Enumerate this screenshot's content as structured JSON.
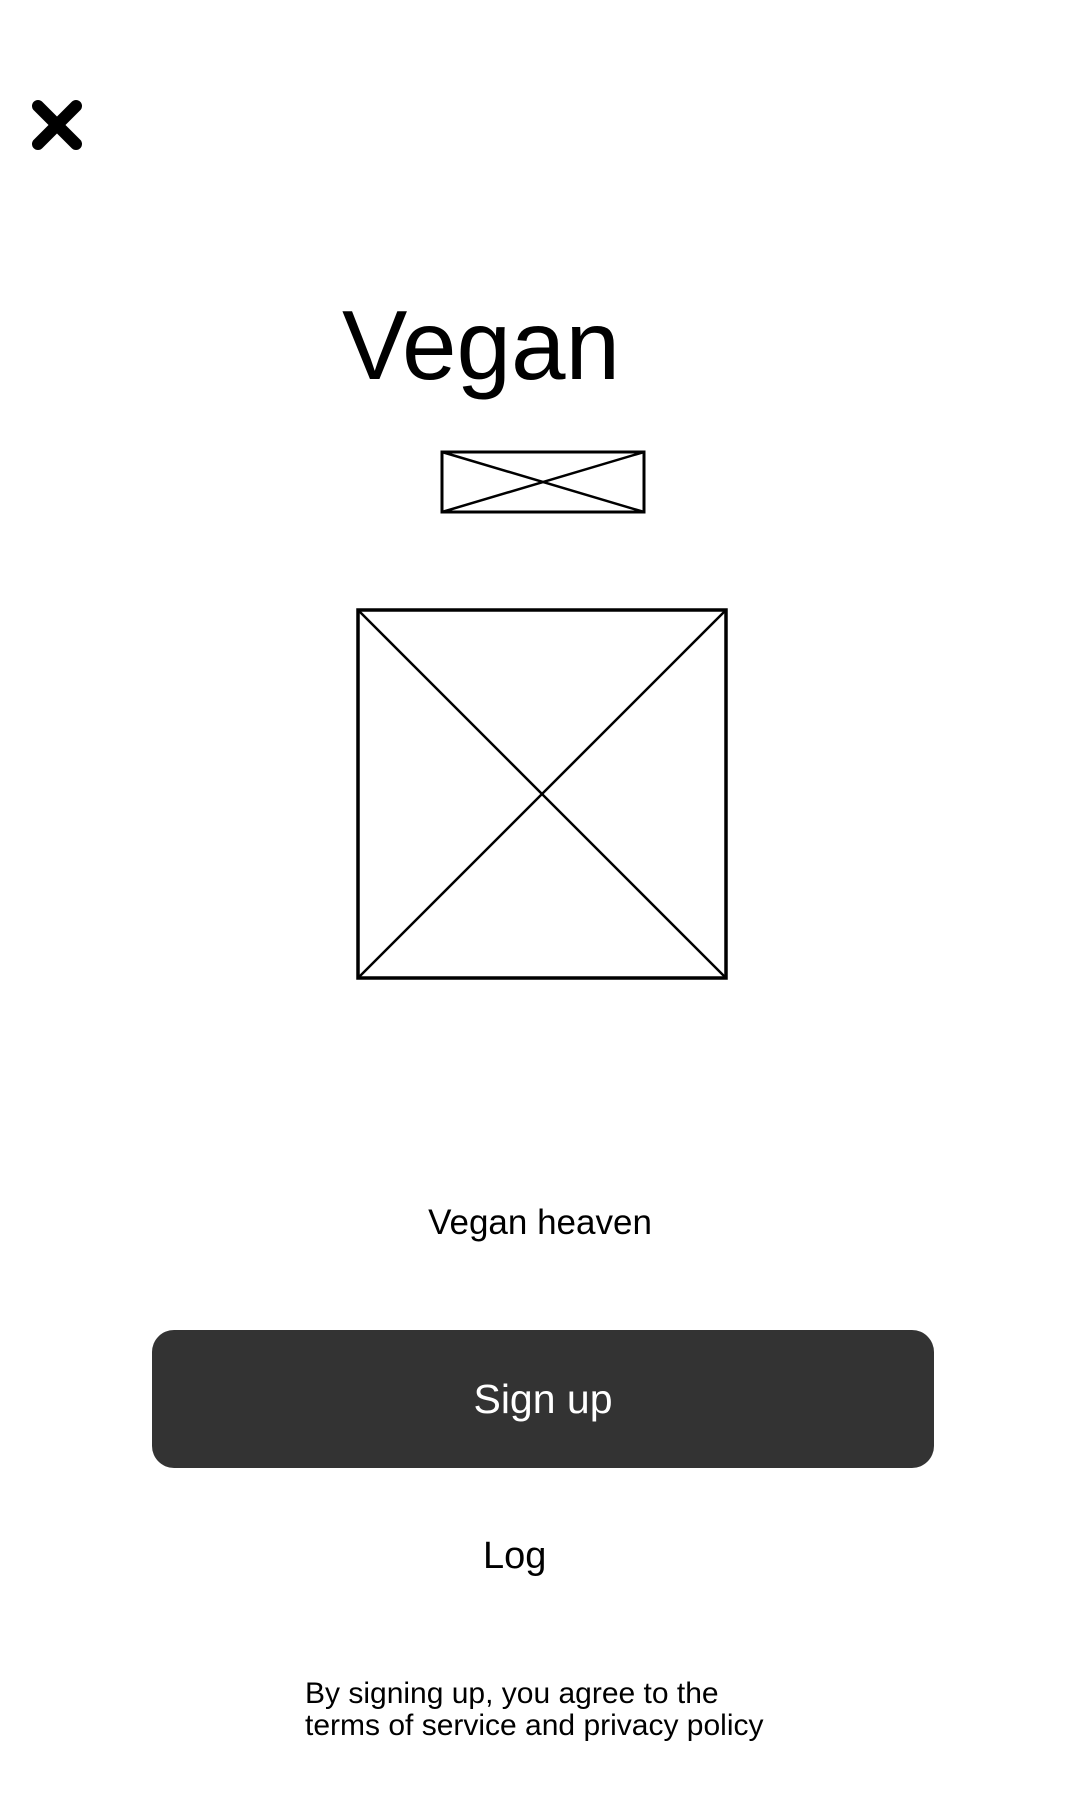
{
  "header": {
    "close_icon": "close-icon"
  },
  "hero": {
    "title": "Vegan",
    "logo_icon": "image-placeholder-icon",
    "image_icon": "image-placeholder-icon"
  },
  "tagline": "Vegan heaven",
  "actions": {
    "signup_label": "Sign up",
    "login_label": "Log"
  },
  "legal": {
    "line1": "By signing up, you agree to the",
    "line2": "terms of service and privacy policy"
  },
  "colors": {
    "button_background": "#333333",
    "button_text": "#ffffff",
    "text": "#000000",
    "background": "#ffffff"
  }
}
